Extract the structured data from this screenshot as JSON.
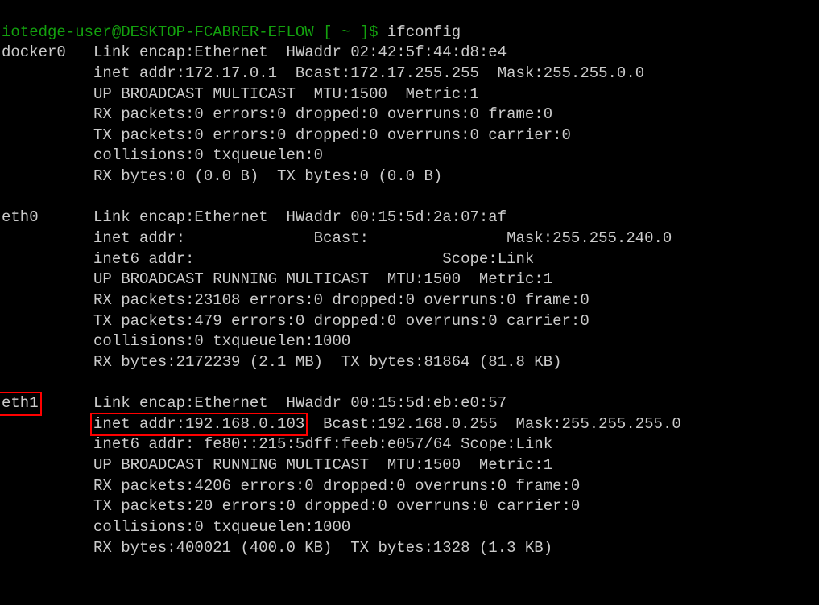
{
  "prompt": {
    "user": "iotedge-user@DESKTOP-FCABRER-EFLOW",
    "path_open": " [ ",
    "path": "~",
    "path_close": " ]$ ",
    "command": "ifconfig"
  },
  "interfaces": [
    {
      "name": "docker0",
      "highlight_name": false,
      "lines": [
        {
          "text": "Link encap:Ethernet  HWaddr 02:42:5f:44:d8:e4"
        },
        {
          "text": "inet addr:172.17.0.1  Bcast:172.17.255.255  Mask:255.255.0.0"
        },
        {
          "text": "UP BROADCAST MULTICAST  MTU:1500  Metric:1"
        },
        {
          "text": "RX packets:0 errors:0 dropped:0 overruns:0 frame:0"
        },
        {
          "text": "TX packets:0 errors:0 dropped:0 overruns:0 carrier:0"
        },
        {
          "text": "collisions:0 txqueuelen:0"
        },
        {
          "text": "RX bytes:0 (0.0 B)  TX bytes:0 (0.0 B)"
        }
      ]
    },
    {
      "name": "eth0",
      "highlight_name": false,
      "lines": [
        {
          "text": "Link encap:Ethernet  HWaddr 00:15:5d:2a:07:af"
        },
        {
          "text": "inet addr:              Bcast:               Mask:255.255.240.0"
        },
        {
          "text": "inet6 addr:                           Scope:Link"
        },
        {
          "text": "UP BROADCAST RUNNING MULTICAST  MTU:1500  Metric:1"
        },
        {
          "text": "RX packets:23108 errors:0 dropped:0 overruns:0 frame:0"
        },
        {
          "text": "TX packets:479 errors:0 dropped:0 overruns:0 carrier:0"
        },
        {
          "text": "collisions:0 txqueuelen:1000"
        },
        {
          "text": "RX bytes:2172239 (2.1 MB)  TX bytes:81864 (81.8 KB)"
        }
      ]
    },
    {
      "name": "eth1",
      "highlight_name": true,
      "lines": [
        {
          "text": "Link encap:Ethernet  HWaddr 00:15:5d:eb:e0:57"
        },
        {
          "hl": "inet addr:192.168.0.103",
          "rest": "  Bcast:192.168.0.255  Mask:255.255.255.0"
        },
        {
          "text": "inet6 addr: fe80::215:5dff:feeb:e057/64 Scope:Link"
        },
        {
          "text": "UP BROADCAST RUNNING MULTICAST  MTU:1500  Metric:1"
        },
        {
          "text": "RX packets:4206 errors:0 dropped:0 overruns:0 frame:0"
        },
        {
          "text": "TX packets:20 errors:0 dropped:0 overruns:0 carrier:0"
        },
        {
          "text": "collisions:0 txqueuelen:1000"
        },
        {
          "text": "RX bytes:400021 (400.0 KB)  TX bytes:1328 (1.3 KB)"
        }
      ]
    }
  ]
}
